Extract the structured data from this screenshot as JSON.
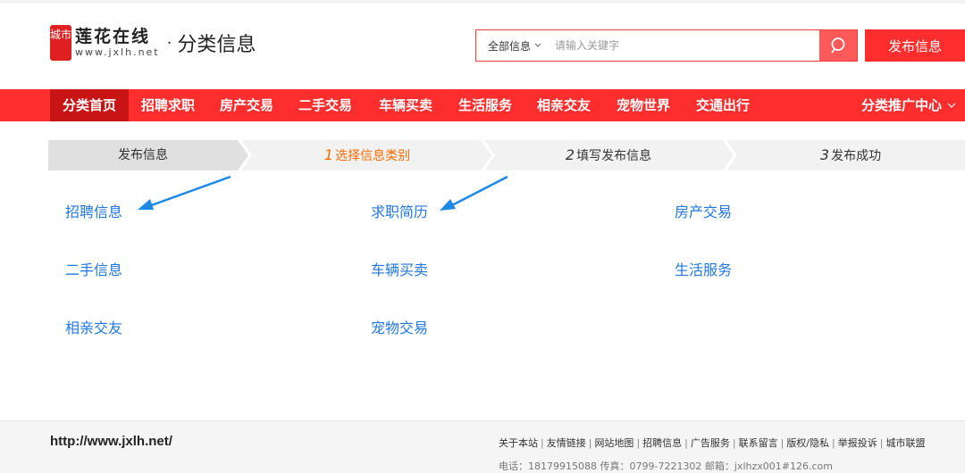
{
  "header": {
    "logo_badge": "城市",
    "logo_name": "莲花在线",
    "logo_domain": "www.jxlh.net",
    "separator": "·",
    "section_title": "分类信息",
    "search_type": "全部信息",
    "search_placeholder": "请输入关键字",
    "publish_label": "发布信息"
  },
  "nav": {
    "items": [
      "分类首页",
      "招聘求职",
      "房产交易",
      "二手交易",
      "车辆买卖",
      "生活服务",
      "相亲交友",
      "宠物世界",
      "交通出行"
    ],
    "active_index": 0,
    "right_label": "分类推广中心"
  },
  "steps": [
    {
      "num": "",
      "label": "发布信息"
    },
    {
      "num": "1",
      "label": "选择信息类别"
    },
    {
      "num": "2",
      "label": "填写发布信息"
    },
    {
      "num": "3",
      "label": "发布成功"
    }
  ],
  "current_step": 1,
  "categories": [
    "招聘信息",
    "求职简历",
    "房产交易",
    "二手信息",
    "车辆买卖",
    "生活服务",
    "相亲交友",
    "宠物交易"
  ],
  "footer": {
    "url": "http://www.jxlh.net/",
    "links": [
      "关于本站",
      "友情链接",
      "网站地图",
      "招聘信息",
      "广告服务",
      "联系留言",
      "版权/隐私",
      "举报投诉",
      "城市联盟"
    ],
    "contact": "电话：18179915088 传真：0799-7221302 邮箱：jxlhzx001#126.com"
  },
  "colors": {
    "accent": "#ff2e2e",
    "nav_active": "#c81414",
    "link": "#2277dd",
    "step_current": "#ff6a00",
    "annotation_arrow": "#1e88e5"
  }
}
